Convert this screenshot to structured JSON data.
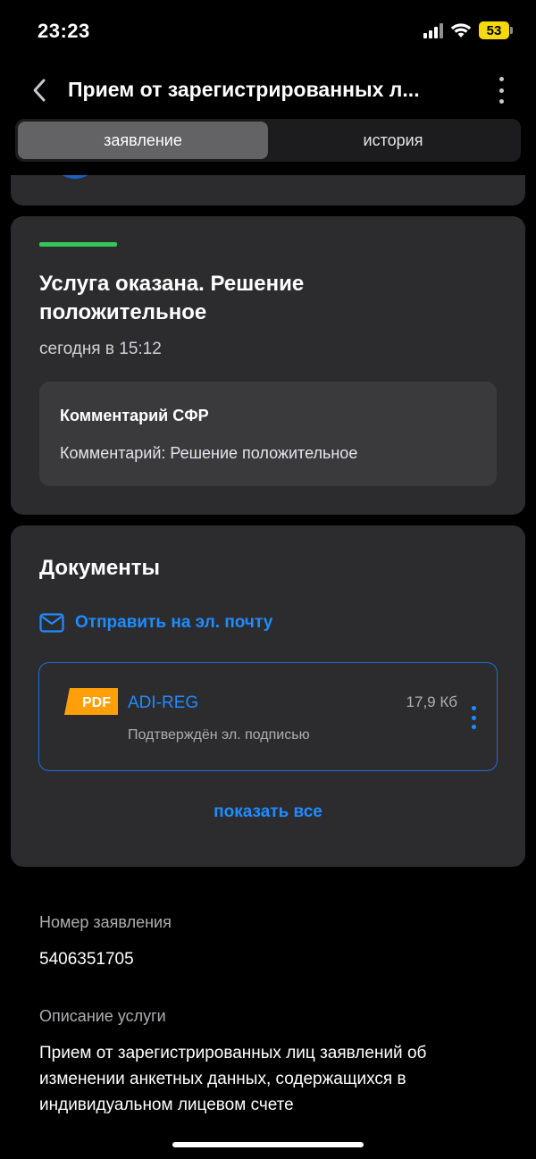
{
  "status_bar": {
    "time": "23:23",
    "battery": "53",
    "icons": [
      "signal-icon",
      "wifi-icon",
      "battery-icon"
    ],
    "battery_color": "#f5d90a"
  },
  "header": {
    "title": "Прием от зарегистрированных л...",
    "back_icon": "chevron-left-icon",
    "menu_icon": "more-vertical-icon"
  },
  "tabs": [
    {
      "label": "заявление",
      "active": true
    },
    {
      "label": "история",
      "active": false
    }
  ],
  "status": {
    "title": "Услуга оказана. Решение положительное",
    "time": "сегодня в 15:12",
    "indicator_color": "#34c759",
    "comment": {
      "title": "Комментарий СФР",
      "text": "Комментарий: Решение положительное"
    }
  },
  "documents": {
    "title": "Документы",
    "email_link": "Отправить на эл. почту",
    "files": [
      {
        "type_badge": "PDF",
        "name": "ADI-REG",
        "size": "17,9 Кб",
        "signature": "Подтверждён эл. подписью"
      }
    ],
    "show_all": "показать все"
  },
  "details": {
    "number_label": "Номер заявления",
    "number_value": "5406351705",
    "description_label": "Описание услуги",
    "description_value": "Прием от зарегистрированных лиц заявлений об изменении анкетных данных, содержащихся в индивидуальном лицевом счете"
  },
  "colors": {
    "accent": "#1f8cff",
    "card_bg": "#2c2c2e",
    "background": "#000000",
    "pdf_badge": "#ff9f0a"
  }
}
